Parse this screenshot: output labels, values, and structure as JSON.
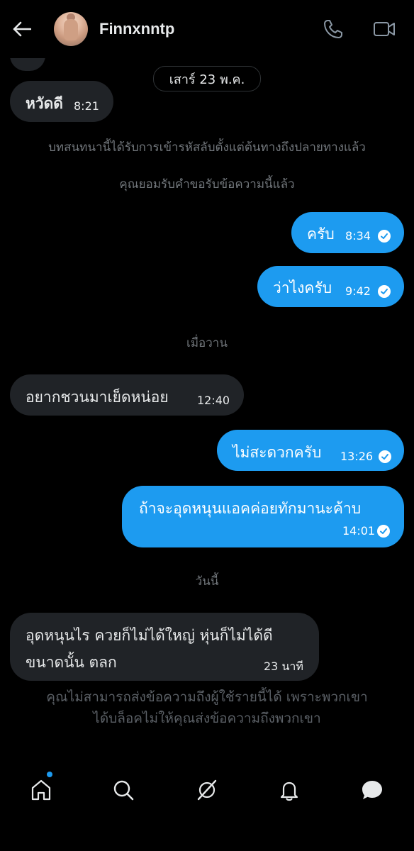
{
  "header": {
    "username": "Finnxnntp",
    "back_icon": "arrow-left-icon",
    "call_icon": "phone-icon",
    "video_icon": "video-camera-icon"
  },
  "date_chip": "เสาร์ 23 พ.ค.",
  "system_messages": {
    "encrypted": "บทสนทนานี้ได้รับการเข้ารหัสลับตั้งแต่ต้นทางถึงปลายทางแล้ว",
    "accepted": "คุณยอมรับคำขอรับข้อความนี้แล้ว"
  },
  "day_labels": {
    "yesterday": "เมื่อวาน",
    "today": "วันนี้"
  },
  "messages": [
    {
      "text": "หวัดดี",
      "time": "8:21",
      "direction": "in"
    },
    {
      "text": "ครับ",
      "time": "8:34",
      "direction": "out",
      "read": true
    },
    {
      "text": "ว่าไงครับ",
      "time": "9:42",
      "direction": "out",
      "read": true
    },
    {
      "text": "อยากชวนมาเย็ดหน่อย",
      "time": "12:40",
      "direction": "in"
    },
    {
      "text": "ไม่สะดวกครับ",
      "time": "13:26",
      "direction": "out",
      "read": true
    },
    {
      "text": "ถ้าจะอุดหนุนแอคค่อยทักมานะค้าบ",
      "time": "14:01",
      "direction": "out",
      "read": true
    },
    {
      "text_line1": "อุดหนุนไร ควยก็ไม่ได้ใหญ่ หุ่นก็ไม่ได้ดี",
      "text_line2": "ขนาดนั้น ตลก",
      "time": "23 นาที",
      "direction": "in"
    }
  ],
  "blocked_notice": {
    "line1": "คุณไม่สามารถส่งข้อความถึงผู้ใช้รายนี้ได้ เพราะพวกเขา",
    "line2": "ได้บล็อคไม่ให้คุณส่งข้อความถึงพวกเขา"
  },
  "nav": {
    "items": [
      "home-icon",
      "search-icon",
      "grok-icon",
      "bell-icon",
      "messages-icon"
    ],
    "accent": "#1d9bf0"
  },
  "colors": {
    "outgoing_bubble": "#1d9bf0",
    "incoming_bubble": "#202327",
    "muted_text": "#71767b"
  }
}
